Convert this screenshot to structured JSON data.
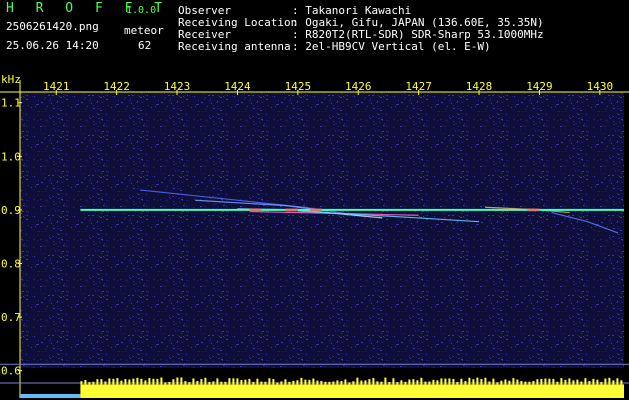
{
  "header": {
    "brand": "H R O F F T",
    "version": "1.0.0",
    "filename": "2506261420.png",
    "datetime": "25.06.26 14:20",
    "mode_label": "meteor",
    "count": "62",
    "fields": [
      {
        "label": "Observer",
        "value": ": Takanori Kawachi"
      },
      {
        "label": "Receiving Location",
        "value": ": Ogaki, Gifu, JAPAN (136.60E, 35.35N)"
      },
      {
        "label": "Receiver",
        "value": ": R820T2(RTL-SDR) SDR-Sharp 53.1000MHz"
      },
      {
        "label": "Receiving antenna",
        "value": ": 2el-HB9CV Vertical (el. E-W)"
      }
    ]
  },
  "colors": {
    "background": "#000000",
    "header_green": "#4dff4d",
    "header_white": "#ffffff",
    "axis_yellow": "#ffff33",
    "noise_blue": "#1a1a66",
    "signal_line": "#00ffcc"
  },
  "chart_data": {
    "type": "heatmap",
    "x_unit": "kHz",
    "x_ticks": [
      "1421",
      "1422",
      "1423",
      "1424",
      "1425",
      "1426",
      "1427",
      "1428",
      "1429",
      "1430"
    ],
    "x_range": [
      1420.4,
      1430.4
    ],
    "y_ticks": [
      "1.1",
      "1.0",
      "0.9",
      "0.8",
      "0.7",
      "0.6"
    ],
    "y_range": [
      0.605,
      1.12
    ],
    "carrier": {
      "y": 0.9,
      "x_start": 1421.4,
      "x_end": 1430.4
    },
    "meteor_echoes": [
      {
        "x": [
          1422.4,
          1425.1,
          1426.1
        ],
        "y": [
          0.937,
          0.905,
          0.888
        ]
      },
      {
        "x": [
          1423.3,
          1424.8,
          1425.5
        ],
        "y": [
          0.918,
          0.908,
          0.898
        ]
      },
      {
        "x": [
          1424.2,
          1425.8,
          1427.0
        ],
        "y": [
          0.897,
          0.893,
          0.89
        ]
      },
      {
        "x": [
          1424.0,
          1425.0,
          1426.4
        ],
        "y": [
          0.902,
          0.9,
          0.885
        ]
      },
      {
        "x": [
          1425.0,
          1427.0,
          1428.0
        ],
        "y": [
          0.898,
          0.885,
          0.878
        ]
      },
      {
        "x": [
          1428.1,
          1429.0,
          1429.5
        ],
        "y": [
          0.905,
          0.9,
          0.895
        ]
      },
      {
        "x": [
          1429.2,
          1429.8,
          1430.3
        ],
        "y": [
          0.895,
          0.878,
          0.857
        ]
      }
    ],
    "power_bar": {
      "low_x_end": 1421.4,
      "low_level": 0.25,
      "high_level": 0.85
    }
  }
}
